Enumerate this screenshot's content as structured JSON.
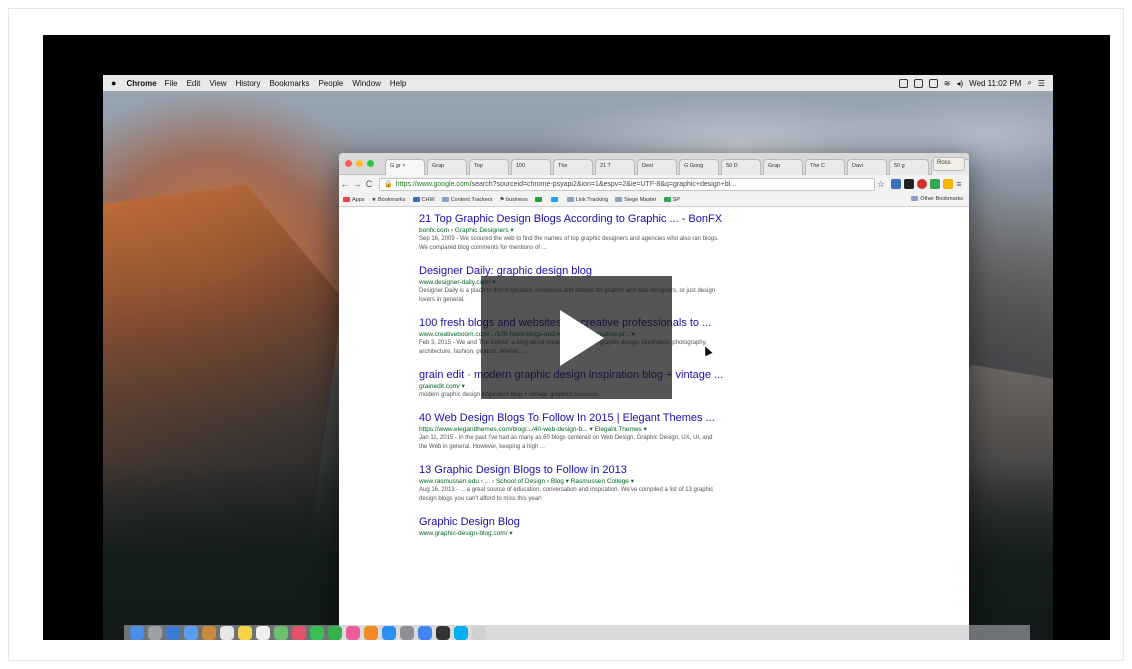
{
  "menubar": {
    "apple": "",
    "app_name": "Chrome",
    "items": [
      "File",
      "Edit",
      "View",
      "History",
      "Bookmarks",
      "People",
      "Window",
      "Help"
    ],
    "clock": "Wed 11:02 PM"
  },
  "chrome": {
    "tabs": [
      "G gr ×",
      "Grap",
      "Top ",
      "100 ",
      "The ",
      "21 T",
      "Desi",
      "G Goog",
      "50 D",
      "Grap",
      "The C",
      "Davi",
      "50 g",
      "Grap"
    ],
    "profile": "Ross",
    "omnibox": {
      "url_host": "https://www.google.com",
      "url_rest": "/search?sourceid=chrome-psyapi2&ion=1&espv=2&ie=UTF-8&q=graphic+design+bl..."
    },
    "bookmarks": [
      "Apps",
      "Bookmarks",
      "CHW",
      "Content Trackers",
      "business",
      "Link Tracking",
      "Siege Master",
      "SP"
    ],
    "other_bookmarks": "Other Bookmarks"
  },
  "results": [
    {
      "title": "21 Top Graphic Design Blogs According to Graphic ... - BonFX",
      "url": "bonfx.com › Graphic Designers ▾",
      "snippet": "Sep 16, 2009 - We scoured the web to find the names of top graphic designers and agencies who also ran blogs. We compared blog comments for mentions of ..."
    },
    {
      "title": "Designer Daily: graphic design blog",
      "url": "www.designer-daily.com/ ▾",
      "snippet": "Designer Daily is a place to find inspiration, resources and articles for graphic and web designers, or just design lovers in general."
    },
    {
      "title": "100 fresh blogs and websites for creative professionals to ...",
      "url": "www.creativeboom.com/.../100-fresh-blogs-and-websites-for-creative-pr... ▾",
      "snippet": "Feb 3, 2015 - We and The Colour: a blog about creative inspiration, graphic design, illustration, photography, architecture, fashion, product, interior, ..."
    },
    {
      "title": "grain edit · modern graphic design inspiration blog + vintage ...",
      "url": "grainedit.com/ ▾",
      "snippet": "modern graphic design inspiration blog + vintage graphics resource."
    },
    {
      "title": "40 Web Design Blogs To Follow In 2015 | Elegant Themes ...",
      "url": "https://www.elegantthemes.com/blog/.../40-web-design-b... ▾ Elegant Themes ▾",
      "snippet": "Jan 11, 2015 - In the past I've had as many as 60 blogs centered on Web Design, Graphic Design, UX, UI, and the Web in general. However, keeping a high ..."
    },
    {
      "title": "13 Graphic Design Blogs to Follow in 2013",
      "url": "www.rasmussen.edu › ... › School of Design › Blog ▾ Rasmussen College ▾",
      "snippet": "Aug 16, 2013 - ... a great source of education, conversation and inspiration. We've compiled a list of 13 graphic design blogs you can't afford to miss this year!"
    },
    {
      "title": "Graphic Design Blog",
      "url": "www.graphic-design-blog.com/ ▾",
      "snippet": ""
    }
  ],
  "colors": {
    "traffic_close": "#fc5f57",
    "traffic_min": "#fdbc2e",
    "traffic_max": "#28c840",
    "link": "#1a0dab",
    "url_green": "#006621"
  },
  "dock_icons": [
    "finder-icon",
    "launchpad-icon",
    "safari-icon",
    "mail-icon",
    "contacts-icon",
    "calendar-icon",
    "notes-icon",
    "reminders-icon",
    "maps-icon",
    "photos-icon",
    "messages-icon",
    "facetime-icon",
    "itunes-icon",
    "ibooks-icon",
    "app-store-icon",
    "system-preferences-icon",
    "chrome-icon",
    "terminal-icon",
    "skype-icon",
    "trash-icon"
  ]
}
